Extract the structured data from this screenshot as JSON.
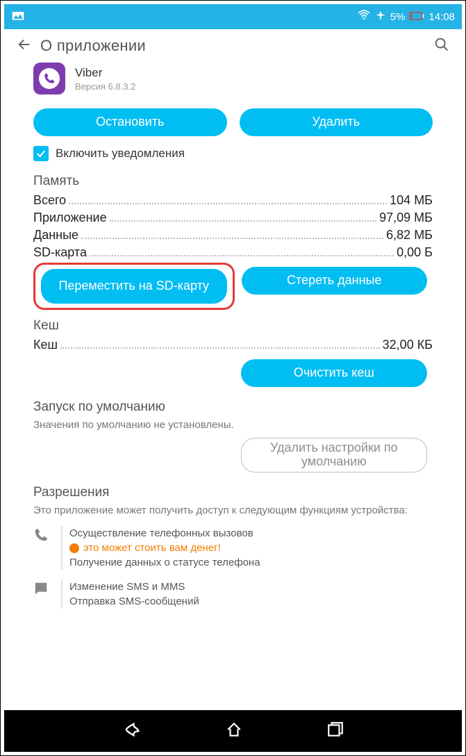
{
  "status": {
    "battery": "5%",
    "time": "14:08"
  },
  "appbar": {
    "title": "О приложении"
  },
  "app": {
    "name": "Viber",
    "version": "Версия 6.8.3.2"
  },
  "buttons": {
    "stop": "Остановить",
    "uninstall": "Удалить",
    "move_sd": "Переместить на SD-карту",
    "clear_data": "Стереть данные",
    "clear_cache": "Очистить кеш",
    "clear_defaults": "Удалить настройки по умолчанию"
  },
  "notify": {
    "label": "Включить уведомления"
  },
  "memory": {
    "title": "Память",
    "total_l": "Всего",
    "total_v": "104 МБ",
    "app_l": "Приложение",
    "app_v": "97,09 МБ",
    "data_l": "Данные",
    "data_v": "6,82 МБ",
    "sd_l": "SD-карта",
    "sd_v": "0,00 Б"
  },
  "cache": {
    "title": "Кеш",
    "label": "Кеш",
    "value": "32,00 КБ"
  },
  "defaults": {
    "title": "Запуск по умолчанию",
    "desc": "Значения по умолчанию не установлены."
  },
  "perms": {
    "title": "Разрешения",
    "desc": "Это приложение может получить доступ к следующим функциям устройства:",
    "phone1": "Осуществление телефонных вызовов",
    "phone_warn": "это может стоить вам денег!",
    "phone2": "Получение данных о статусе телефона",
    "sms1": "Изменение SMS и MMS",
    "sms2": "Отправка SMS-сообщений"
  }
}
